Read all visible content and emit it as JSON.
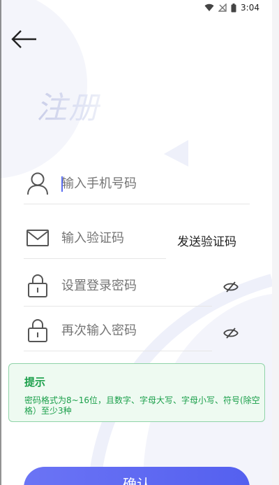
{
  "status_bar": {
    "time": "3:04",
    "icons": [
      "wifi-icon",
      "no-signal-icon",
      "battery-icon"
    ]
  },
  "header": {
    "back_icon": "arrow-left-icon",
    "title": "注册"
  },
  "form": {
    "phone": {
      "placeholder": "输入手机号码",
      "icon": "user-icon"
    },
    "code": {
      "placeholder": "输入验证码",
      "icon": "mail-icon",
      "send_label": "发送验证码"
    },
    "password": {
      "placeholder": "设置登录密码",
      "icon": "lock-icon",
      "toggle_icon": "eye-off-icon"
    },
    "confirm_password": {
      "placeholder": "再次输入密码",
      "icon": "lock-icon",
      "toggle_icon": "eye-off-icon"
    }
  },
  "tip": {
    "title": "提示",
    "text": "密码格式为8~16位，且数字、字母大写、字母小写、符号(除空格）至少3种"
  },
  "confirm_label": "确认",
  "colors": {
    "accent": "#5a65f0",
    "tip_green": "#1a9f4a",
    "tip_bg": "#eefaf1",
    "tip_border": "#8fd3a8",
    "placeholder": "#8e8e8e"
  }
}
